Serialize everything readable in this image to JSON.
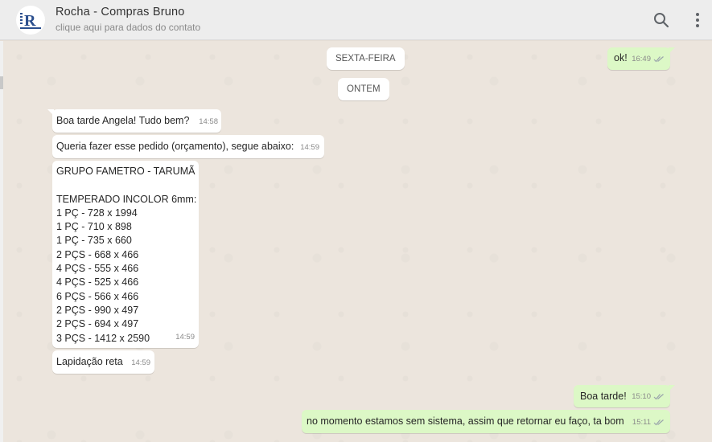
{
  "header": {
    "contact_name": "Rocha - Compras Bruno",
    "contact_subtitle": "clique aqui para dados do contato",
    "avatar_initial": "R",
    "icons": [
      "search-icon",
      "menu-dots-icon"
    ]
  },
  "colors": {
    "header_bg": "#ededed",
    "chat_bg": "#ece5dd",
    "incoming_bg": "#ffffff",
    "outgoing_bg": "#dcf8c6",
    "ticks": "#9aa4ab",
    "logo_blue": "#2b4f8e"
  },
  "date_separators": [
    "SEXTA-FEIRA",
    "ONTEM"
  ],
  "messages": [
    {
      "direction": "out",
      "text": "ok!",
      "time": "16:49",
      "status": "delivered"
    },
    {
      "direction": "in",
      "text": "Boa tarde Angela! Tudo bem?",
      "time": "14:58"
    },
    {
      "direction": "in",
      "text": "Queria fazer esse pedido (orçamento), segue abaixo:",
      "time": "14:59"
    },
    {
      "direction": "in",
      "text": "GRUPO FAMETRO - TARUMÃ\n\nTEMPERADO INCOLOR 6mm:\n1 PÇ - 728 x 1994\n1 PÇ - 710 x 898\n1 PÇ - 735 x 660\n2 PÇS - 668 x 466\n4 PÇS - 555 x 466\n4 PÇS - 525 x 466\n6 PÇS - 566 x 466\n2 PÇS - 990 x 497\n2 PÇS - 694 x 497\n3 PÇS - 1412 x 2590",
      "time": "14:59"
    },
    {
      "direction": "in",
      "text": "Lapidação reta",
      "time": "14:59"
    },
    {
      "direction": "out",
      "text": "Boa tarde!",
      "time": "15:10",
      "status": "delivered"
    },
    {
      "direction": "out",
      "text": "no momento estamos sem sistema, assim que retornar eu faço, ta bom",
      "time": "15:11",
      "status": "delivered"
    }
  ]
}
